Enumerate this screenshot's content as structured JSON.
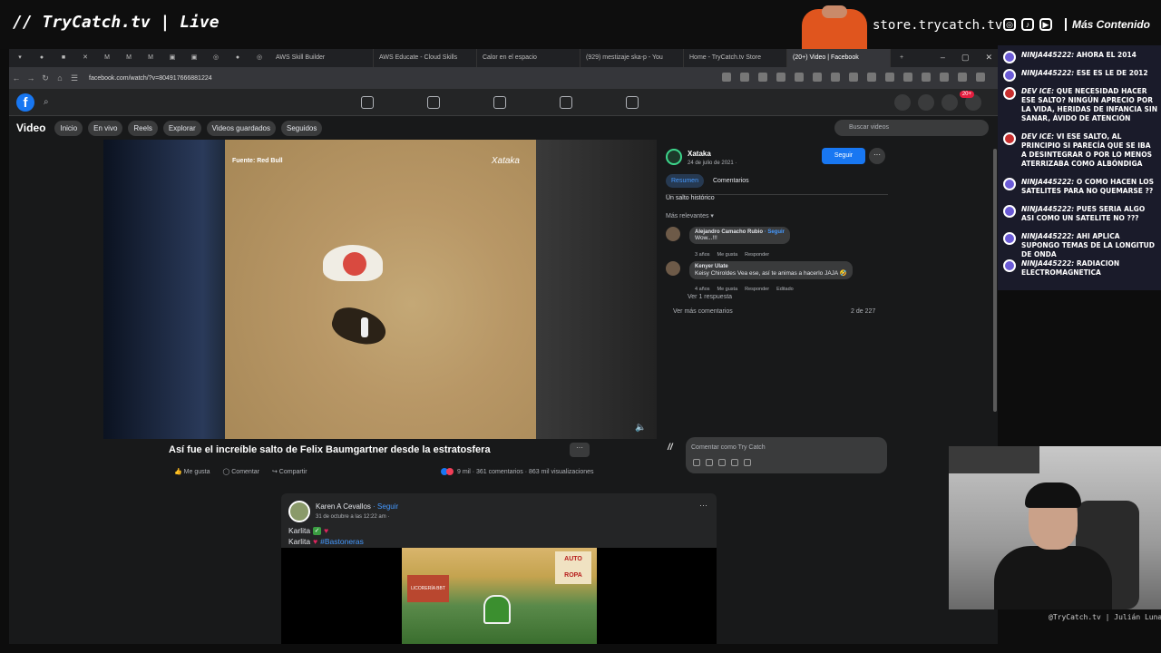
{
  "stream": {
    "brand": "// TryCatch.tv | Live",
    "store": "store.trycatch.tv",
    "mas_contenido": "Más Contenido",
    "credit": "@TryCatch.tv | Julián Luna"
  },
  "browser": {
    "tabs": [
      {
        "label": "AWS Skill Builder"
      },
      {
        "label": "AWS Educate - Cloud Skills"
      },
      {
        "label": "Calor en el espacio"
      },
      {
        "label": "(929) mestizaje ska-p - You"
      },
      {
        "label": "Home - TryCatch.tv Store"
      },
      {
        "label": "(20+) Video | Facebook"
      }
    ],
    "url": "facebook.com/watch/?v=804917666881224"
  },
  "facebook": {
    "notifications": "20+",
    "video_section_title": "Video",
    "pills": [
      "Inicio",
      "En vivo",
      "Reels",
      "Explorar",
      "Videos guardados",
      "Seguidos"
    ],
    "search_placeholder": "Buscar videos",
    "video": {
      "source_label": "Fuente: Red Bull",
      "watermark": "Xataka",
      "title": "Así fue el increíble salto de Felix Baumgartner desde la estratosfera",
      "actions": {
        "like": "Me gusta",
        "comment": "Comentar",
        "share": "Compartir"
      },
      "stats": "9 mil · 361 comentarios · 863 mil visualizaciones"
    },
    "page": {
      "name": "Xataka",
      "date": "24 de julio de 2021 · ",
      "follow": "Seguir",
      "tabs": [
        "Resumen",
        "Comentarios"
      ],
      "description": "Un salto histórico",
      "relevance": "Más relevantes ▾"
    },
    "comments": [
      {
        "author": "Alejandro Camacho Rubio",
        "follow": " · Seguir",
        "text": "Wow...!!!",
        "meta": [
          "3 años",
          "Me gusta",
          "Responder"
        ]
      },
      {
        "author": "Kenyer Ulate",
        "follow": "",
        "text": "Keisy Chiroldes Vea ese, así te animas a hacerlo JAJA 🤣",
        "meta": [
          "4 años",
          "Me gusta",
          "Responder",
          "Editado"
        ]
      }
    ],
    "see_replies": "Ver 1 respuesta",
    "see_more": "Ver más comentarios",
    "comment_count": "2 de 227",
    "comment_placeholder": "Comentar como Try Catch",
    "feed_post": {
      "author": "Karen A Cevallos",
      "follow": " · Seguir",
      "date": "31 de octubre a las 12:22 am · ",
      "line1": "Karlita",
      "line2": "Karlita",
      "hashtag": "#Bastoneras",
      "image_texts": {
        "shop": "LICORERÍA BBT",
        "sign": "AUTO ROPA"
      }
    }
  },
  "chat": [
    {
      "user": "NINJA445222:",
      "text": " AHORA EL 2014",
      "avatar": "purple"
    },
    {
      "user": "NINJA445222:",
      "text": " ESE ES LE DE 2012",
      "avatar": "purple"
    },
    {
      "user": "DEV ICE:",
      "text": " QUE NECESIDAD HACER ESE SALTO? NINGÚN APRECIO POR LA VIDA, HERIDAS DE INFANCIA SIN SANAR, ÁVIDO DE ATENCIÓN",
      "avatar": "red"
    },
    {
      "user": "DEV ICE:",
      "text": " VI ESE SALTO, AL PRINCIPIO SI PARECÍA QUE SE IBA A DESINTEGRAR O POR LO MENOS ATERRIZABA COMO ALBÓNDIGA",
      "avatar": "red"
    },
    {
      "user": "NINJA445222:",
      "text": " O COMO HACEN LOS SATELITES PARA NO QUEMARSE ??",
      "avatar": "purple"
    },
    {
      "user": "NINJA445222:",
      "text": " PUES SERIA ALGO ASI COMO UN SATELITE NO ???",
      "avatar": "purple"
    },
    {
      "user": "NINJA445222:",
      "text": " AHI APLICA SUPONGO TEMAS DE LA LONGITUD DE ONDA",
      "avatar": "purple"
    },
    {
      "user": "NINJA445222:",
      "text": " RADIACION ELECTROMAGNETICA",
      "avatar": "purple"
    }
  ],
  "colors": {
    "accent": "#1877f2",
    "chat_bg": "#1a1b2a",
    "stream_accent": "#e0551e"
  }
}
